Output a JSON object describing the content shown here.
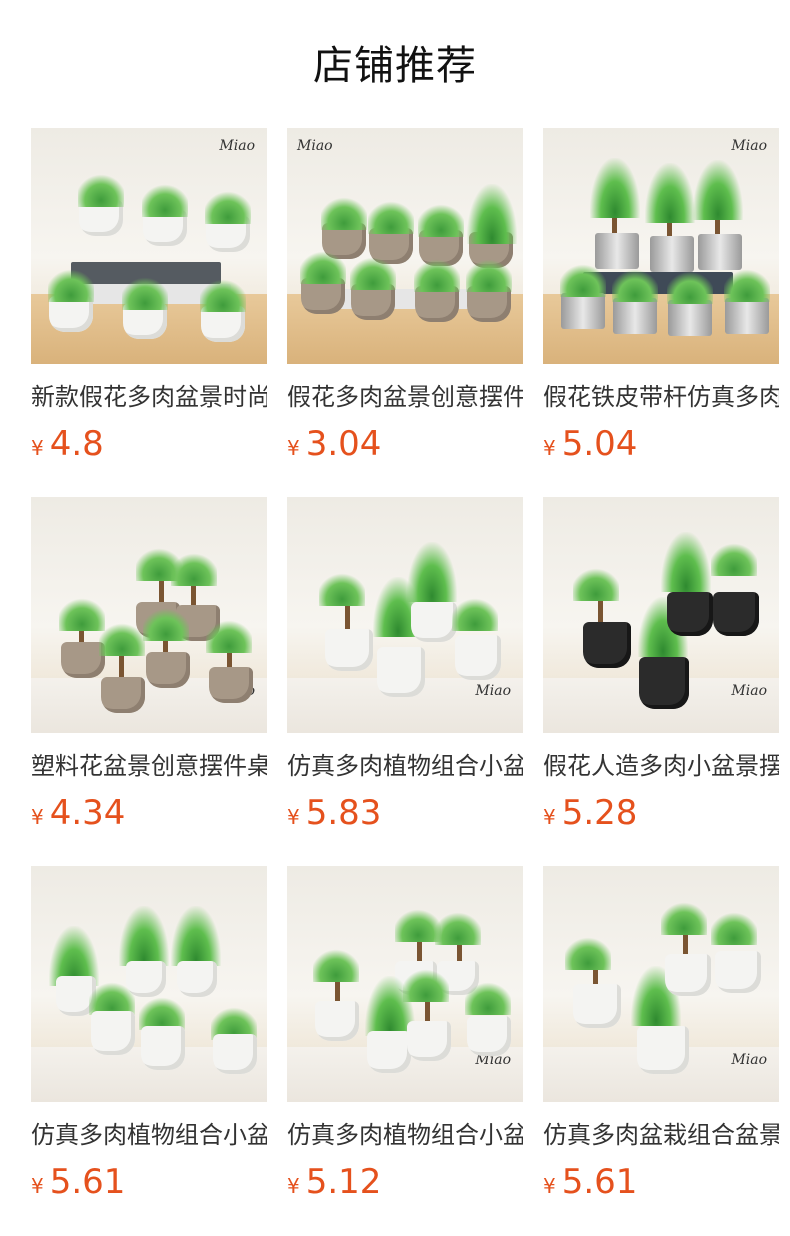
{
  "section_title": "店铺推荐",
  "currency_symbol": "¥",
  "brand_mark": "Miao",
  "products": [
    {
      "name": "新款假花多肉盆景时尚",
      "price": "4.8"
    },
    {
      "name": "假花多肉盆景创意摆件",
      "price": "3.04"
    },
    {
      "name": "假花铁皮带杆仿真多肉",
      "price": "5.04"
    },
    {
      "name": "塑料花盆景创意摆件桌",
      "price": "4.34"
    },
    {
      "name": "仿真多肉植物组合小盆",
      "price": "5.83"
    },
    {
      "name": "假花人造多肉小盆景摆",
      "price": "5.28"
    },
    {
      "name": "仿真多肉植物组合小盆",
      "price": "5.61"
    },
    {
      "name": "仿真多肉植物组合小盆",
      "price": "5.12"
    },
    {
      "name": "仿真多肉盆栽组合盆景",
      "price": "5.61"
    }
  ]
}
